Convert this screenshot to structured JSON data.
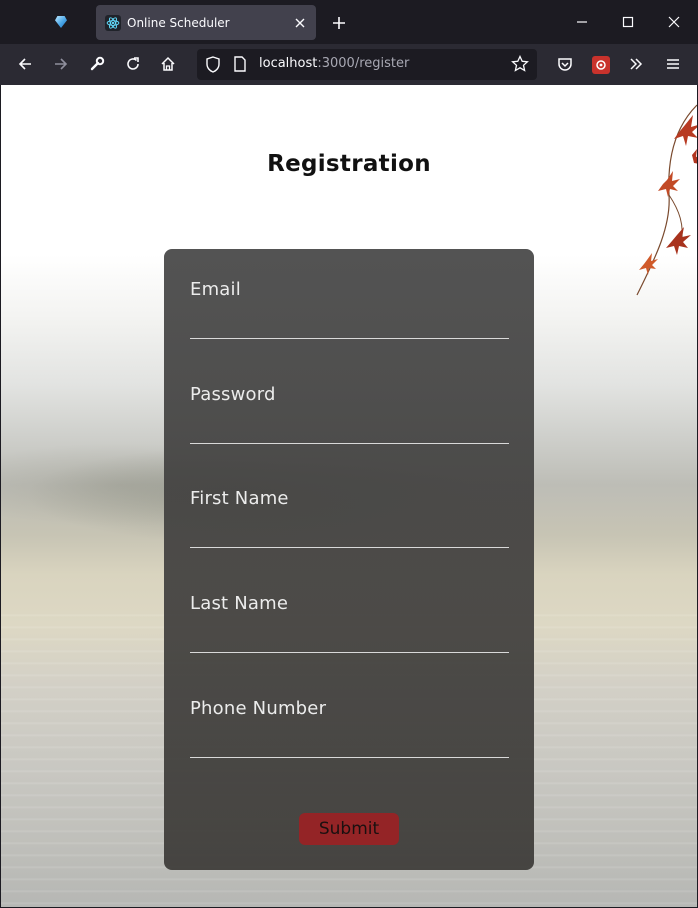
{
  "browser": {
    "tab_title": "Online Scheduler",
    "url_host": "localhost",
    "url_path": ":3000/register"
  },
  "page": {
    "title": "Registration",
    "fields": [
      {
        "label": "Email",
        "value": ""
      },
      {
        "label": "Password",
        "value": ""
      },
      {
        "label": "First Name",
        "value": ""
      },
      {
        "label": "Last Name",
        "value": ""
      },
      {
        "label": "Phone Number",
        "value": ""
      }
    ],
    "submit_label": "Submit"
  },
  "colors": {
    "browser_bg": "#1c1b22",
    "toolbar_bg": "#2b2a33",
    "card_bg": "#474747",
    "submit_bg": "#942426"
  }
}
